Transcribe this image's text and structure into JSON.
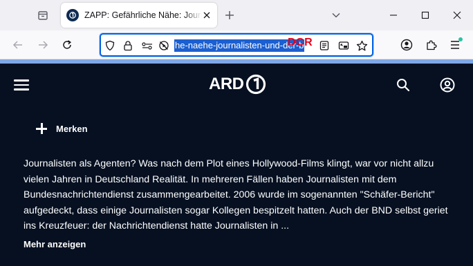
{
  "browser": {
    "tab": {
      "title": "ZAPP: Gefährliche Nähe: Journalisten und der BND"
    },
    "url": {
      "visible_text": "he-naehe-journalisten-und-der-b",
      "overlay_text": "DCR"
    },
    "colors": {
      "url_focus": "#0061e0",
      "selection": "#1c5fd0",
      "accent_strip": "#7fa8e6"
    }
  },
  "site": {
    "logo_text": "ARD",
    "merken_label": "Merken",
    "description": "Journalisten als Agenten? Was nach dem Plot eines Hollywood-Films klingt, war vor nicht allzu vielen Jahren in Deutschland Realität. In mehreren Fällen haben Journalisten mit dem Bundesnachrichtendienst zusammengearbeitet. 2006 wurde im sogenannten \"Schäfer-Bericht\" aufgedeckt, dass einige Journalisten sogar Kollegen bespitzelt hatten. Auch der BND selbst geriet ins Kreuzfeuer: der Nachrichtendienst hatte Journalisten in ...",
    "more_label": "Mehr anzeigen",
    "colors": {
      "background": "#061021",
      "text": "#ffffff"
    }
  }
}
